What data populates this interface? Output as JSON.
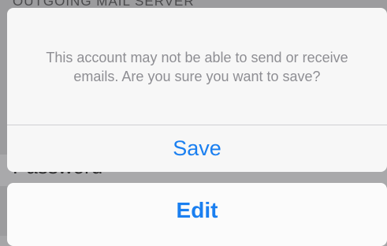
{
  "background": {
    "section_header": "OUTGOING MAIL SERVER",
    "row_label": "Password",
    "row_value": "••••••••"
  },
  "alert": {
    "message": "This account may not be able to send or receive emails. Are you sure you want to save?",
    "save_label": "Save",
    "edit_label": "Edit"
  },
  "colors": {
    "accent": "#1a7ff0",
    "message_text": "#8e8e93",
    "sheet_background": "#f7f7f7"
  }
}
